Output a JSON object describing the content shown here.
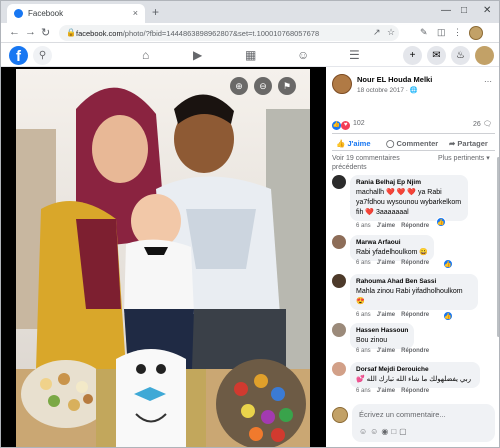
{
  "browser": {
    "tab_title": "Facebook",
    "tab_close": "×",
    "new_tab": "+",
    "url_host": "facebook.com",
    "url_path": "/photo/?fbid=1444863898962807&set=t.100010768057678"
  },
  "facebook_nav": {
    "logo": "f",
    "icons": [
      "home-icon",
      "watch-icon",
      "marketplace-icon",
      "groups-icon",
      "menu-icon"
    ],
    "right_icons": [
      "create-icon",
      "messenger-icon",
      "notifications-icon",
      "account-icon"
    ]
  },
  "post": {
    "author": "Nour EL Houda Melki",
    "date": "18 octobre 2017 · ",
    "reaction_count": "102",
    "comment_count": "26",
    "actions": {
      "like": "J'aime",
      "comment": "Commenter",
      "share": "Partager"
    },
    "view_previous": "Voir 19 commentaires précédents",
    "sort": "Plus pertinents ▾"
  },
  "comments": [
    {
      "author": "Rania Belhaj Ep Njim",
      "text": "machallh ❤️ ❤️ ❤️ ya Rabi ya7fdhou wysounou wybarkelkom fih ❤️ 3aaaaaaal",
      "age": "6 ans",
      "like": "J'aime",
      "reply": "Répondre"
    },
    {
      "author": "Marwa Arfaoui",
      "text": "Rabi yfadelhoulkom 😀",
      "age": "6 ans",
      "like": "J'aime",
      "reply": "Répondre"
    },
    {
      "author": "Rahouma Ahad Ben Sassi",
      "text": "Mahla zinou Rabi yifadholhoulkom 😍",
      "age": "6 ans",
      "like": "J'aime",
      "reply": "Répondre"
    },
    {
      "author": "Hassen Hassoun",
      "text": "Bou zinou",
      "age": "6 ans",
      "like": "J'aime",
      "reply": "Répondre"
    },
    {
      "author": "Dorsaf Mejdi Derouiche",
      "text": "ربي يفضلهولك ما شاء الله تبارك الله 💕",
      "age": "6 ans",
      "like": "J'aime",
      "reply": "Répondre"
    }
  ],
  "composer": {
    "placeholder": "Écrivez un commentaire..."
  },
  "colors": {
    "facebook_blue": "#1877f2",
    "panel_bg": "#ffffff",
    "bubble_bg": "#f0f2f5"
  }
}
